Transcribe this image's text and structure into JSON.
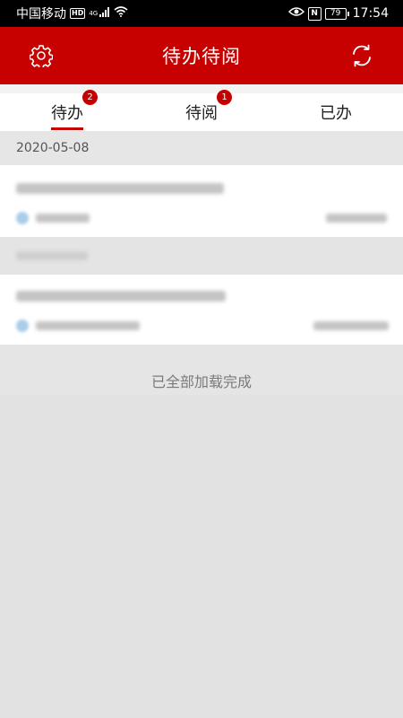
{
  "status_bar": {
    "carrier": "中国移动",
    "hd": "HD",
    "network": "4G",
    "battery": "79",
    "time": "17:54"
  },
  "app_bar": {
    "title": "待办待阅",
    "left_icon": "gear-icon",
    "right_icon": "refresh-icon"
  },
  "tabs": [
    {
      "label": "待办",
      "badge": "2",
      "active": true
    },
    {
      "label": "待阅",
      "badge": "1",
      "active": false
    },
    {
      "label": "已办",
      "badge": "",
      "active": false
    }
  ],
  "list": {
    "date_group": "2020-05-08",
    "footer_text": "已全部加载完成"
  },
  "colors": {
    "brand": "#c70000",
    "background": "#e2e2e2"
  }
}
